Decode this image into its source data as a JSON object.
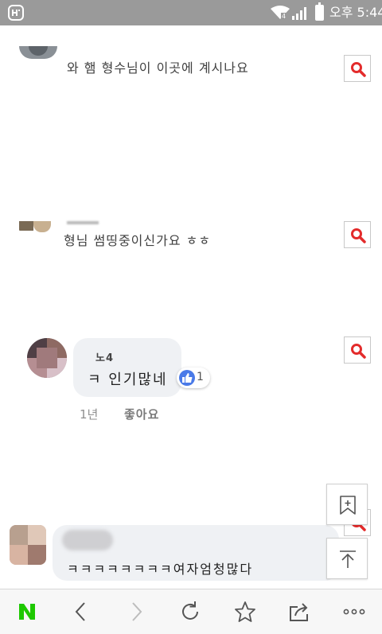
{
  "status_bar": {
    "time": "오후 5:44",
    "icons": [
      "app-icon",
      "wifi-icon",
      "signal-icon",
      "battery-icon"
    ]
  },
  "comments": [
    {
      "text": "와 햄 형수님이 이곳에 계시나요"
    },
    {
      "text": "형님 썸띵중이신가요 ㅎㅎ"
    },
    {
      "name": "노4",
      "text": "ㅋ 인기많네",
      "like_count": "1",
      "time": "1년",
      "like_label": "좋아요"
    },
    {
      "text": "ㅋㅋㅋㅋㅋㅋㅋㅋ여자엄청많다"
    }
  ],
  "floating": {
    "bookmark_add": "bookmark-add-icon",
    "scroll_top": "scroll-to-top-icon"
  },
  "toolbar": {
    "home_label": "N",
    "items": [
      "naver-home-icon",
      "back-icon",
      "forward-icon",
      "refresh-icon",
      "star-icon",
      "share-icon",
      "more-icon"
    ]
  },
  "colors": {
    "search_accent": "#e32b2b",
    "naver_green": "#1ec800",
    "status_bar": "#9a9a9a",
    "like_blue": "#4a7ae8"
  }
}
